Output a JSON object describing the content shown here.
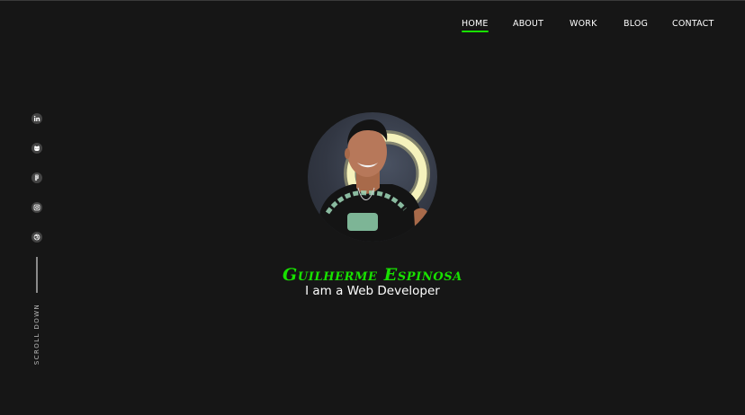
{
  "nav": {
    "items": [
      {
        "label": "HOME",
        "active": true
      },
      {
        "label": "ABOUT",
        "active": false
      },
      {
        "label": "WORK",
        "active": false
      },
      {
        "label": "BLOG",
        "active": false
      },
      {
        "label": "CONTACT",
        "active": false
      }
    ]
  },
  "social": {
    "icons": [
      "linkedin-icon",
      "github-icon",
      "figma-icon",
      "instagram-icon",
      "dribbble-icon"
    ]
  },
  "scroll": {
    "label": "SCROLL DOWN"
  },
  "hero": {
    "name": "Guilherme Espinosa",
    "role": "I am a Web Developer"
  },
  "colors": {
    "background": "#161616",
    "accent": "#18e100",
    "text": "#ffffff"
  }
}
